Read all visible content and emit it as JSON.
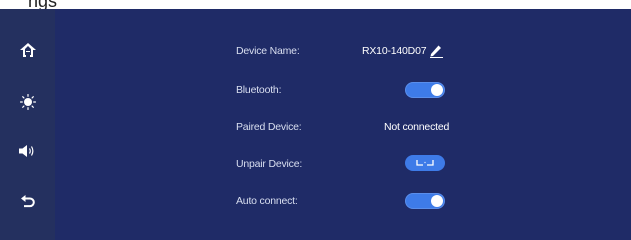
{
  "top": {
    "partial_text": "ngs"
  },
  "sidebar": {
    "items": [
      {
        "icon": "home-icon"
      },
      {
        "icon": "brightness-icon"
      },
      {
        "icon": "volume-icon"
      },
      {
        "icon": "back-icon"
      }
    ]
  },
  "settings": {
    "device_name": {
      "label": "Device Name:",
      "value": "RX10-140D07"
    },
    "bluetooth": {
      "label": "Bluetooth:",
      "state": "on"
    },
    "paired_device": {
      "label": "Paired Device:",
      "value": "Not connected"
    },
    "unpair_device": {
      "label": "Unpair Device:"
    },
    "auto_connect": {
      "label": "Auto connect:",
      "state": "on"
    }
  },
  "colors": {
    "sidebar_bg": "#24305f",
    "main_bg": "#1f2b67",
    "accent": "#3e7be8",
    "label_text": "#d9dff0",
    "value_text": "#ffffff"
  }
}
